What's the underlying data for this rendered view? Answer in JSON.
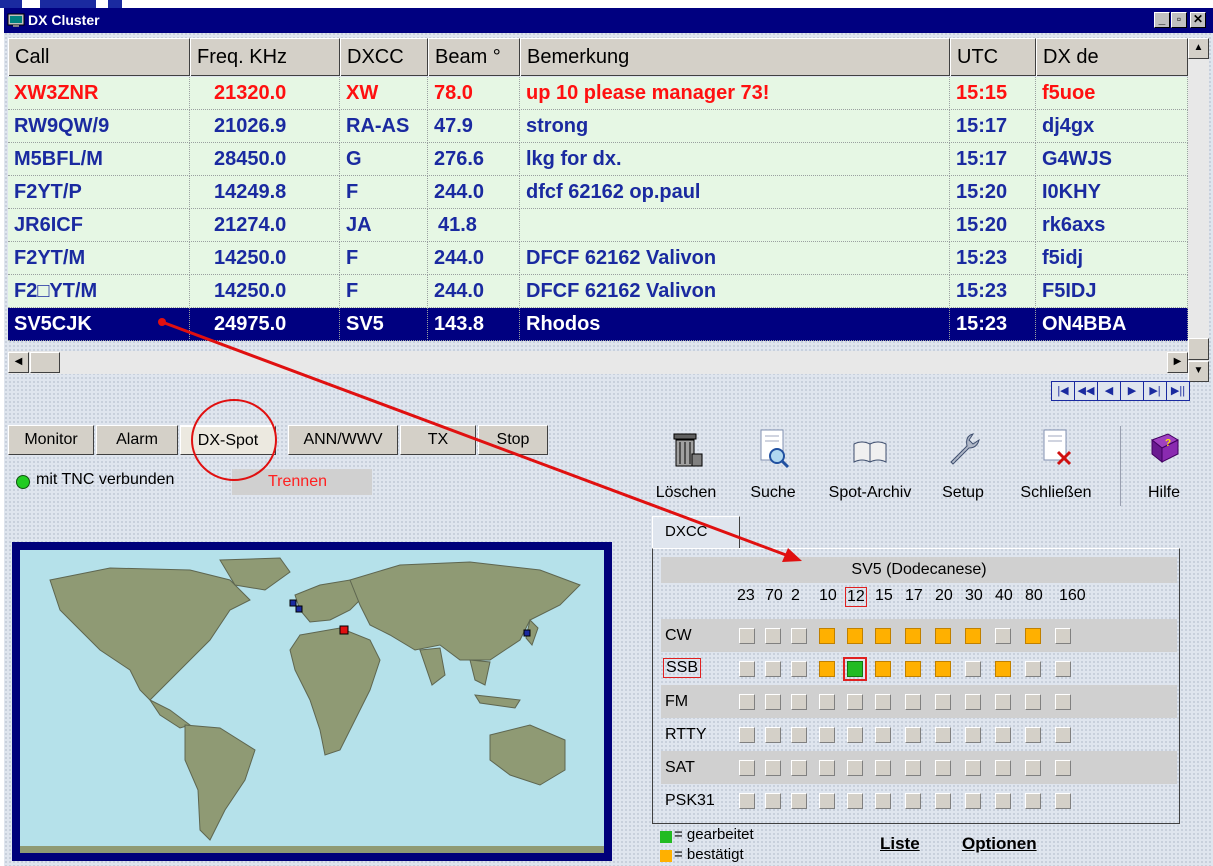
{
  "window": {
    "title": "DX Cluster"
  },
  "window_controls": [
    "_",
    "▫",
    "✕"
  ],
  "columns": [
    "Call",
    "Freq. KHz",
    "DXCC",
    "Beam °",
    "Bemerkung",
    "UTC",
    "DX de"
  ],
  "rows": [
    {
      "call": "XW3ZNR",
      "freq": "21320.0",
      "dxcc": "XW",
      "beam": "78.0",
      "remark": "up 10 please manager 73!",
      "utc": "15:15",
      "dxde": "f5uoe"
    },
    {
      "call": "RW9QW/9",
      "freq": "21026.9",
      "dxcc": "RA-AS",
      "beam": "47.9",
      "remark": "strong",
      "utc": "15:17",
      "dxde": "dj4gx"
    },
    {
      "call": "M5BFL/M",
      "freq": "28450.0",
      "dxcc": "G",
      "beam": "276.6",
      "remark": "lkg for dx.",
      "utc": "15:17",
      "dxde": "G4WJS"
    },
    {
      "call": "F2YT/P",
      "freq": "14249.8",
      "dxcc": "F",
      "beam": "244.0",
      "remark": "dfcf 62162 op.paul",
      "utc": "15:20",
      "dxde": "I0KHY"
    },
    {
      "call": "JR6ICF",
      "freq": "21274.0",
      "dxcc": "JA",
      "beam": "41.8",
      "remark": "",
      "utc": "15:20",
      "dxde": "rk6axs"
    },
    {
      "call": "F2YT/M",
      "freq": "14250.0",
      "dxcc": "F",
      "beam": "244.0",
      "remark": "DFCF 62162 Valivon",
      "utc": "15:23",
      "dxde": "f5idj"
    },
    {
      "call": "F2□YT/M",
      "freq": "14250.0",
      "dxcc": "F",
      "beam": "244.0",
      "remark": "DFCF 62162 Valivon",
      "utc": "15:23",
      "dxde": "F5IDJ"
    },
    {
      "call": "SV5CJK",
      "freq": "24975.0",
      "dxcc": "SV5",
      "beam": "143.8",
      "remark": "Rhodos",
      "utc": "15:23",
      "dxde": "ON4BBA"
    }
  ],
  "tabs": {
    "monitor": "Monitor",
    "alarm": "Alarm",
    "dxspot": "DX-Spot",
    "ann": "ANN/WWV",
    "tx": "TX",
    "stop": "Stop"
  },
  "connection": {
    "status": "mit TNC verbunden",
    "button": "Trennen",
    "status_color": "#22cc22"
  },
  "toolbar": {
    "loeschen": "Löschen",
    "suche": "Suche",
    "archiv": "Spot-Archiv",
    "setup": "Setup",
    "schliessen": "Schließen",
    "hilfe": "Hilfe"
  },
  "dxcc": {
    "tab": "DXCC",
    "entity": "SV5 (Dodecanese)",
    "bands": [
      "23",
      "70",
      "2",
      "10",
      "12",
      "15",
      "17",
      "20",
      "30",
      "40",
      "80",
      "160"
    ],
    "selected_band": "12",
    "modes": [
      "CW",
      "SSB",
      "FM",
      "RTTY",
      "SAT",
      "PSK31"
    ],
    "selected_mode": "SSB",
    "status_grid": {
      "CW": [
        "",
        "",
        "",
        "c",
        "c",
        "c",
        "c",
        "c",
        "c",
        "",
        "c",
        ""
      ],
      "SSB": [
        "",
        "",
        "",
        "c",
        "w",
        "c",
        "c",
        "c",
        "",
        "c",
        "",
        ""
      ],
      "FM": [
        "",
        "",
        "",
        "",
        "",
        "",
        "",
        "",
        "",
        "",
        "",
        ""
      ],
      "RTTY": [
        "",
        "",
        "",
        "",
        "",
        "",
        "",
        "",
        "",
        "",
        "",
        ""
      ],
      "SAT": [
        "",
        "",
        "",
        "",
        "",
        "",
        "",
        "",
        "",
        "",
        "",
        ""
      ],
      "PSK31": [
        "",
        "",
        "",
        "",
        "",
        "",
        "",
        "",
        "",
        "",
        "",
        ""
      ]
    },
    "legend_worked": "= gearbeitet",
    "legend_confirmed": "= bestätigt",
    "worked_color": "#22bb22",
    "confirmed_color": "#ffb000",
    "link_list": "Liste",
    "link_options": "Optionen"
  },
  "colors": {
    "title_bg": "#000080",
    "row_bg": "#e6f7e4",
    "row_text": "#1a2aa0",
    "row_alert": "#ff1010"
  }
}
